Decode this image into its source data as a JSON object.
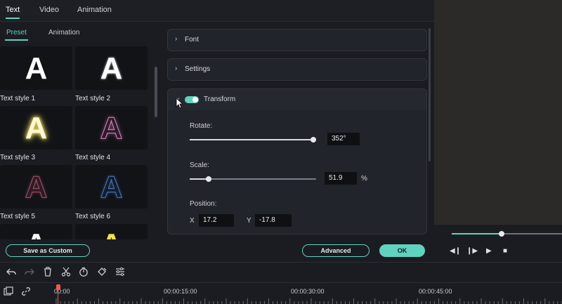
{
  "top_tabs": [
    {
      "label": "Text",
      "active": true
    },
    {
      "label": "Video",
      "active": false
    },
    {
      "label": "Animation",
      "active": false
    }
  ],
  "sub_tabs": [
    {
      "label": "Preset",
      "active": true
    },
    {
      "label": "Animation",
      "active": false
    }
  ],
  "presets": [
    {
      "glyph": "A",
      "label": "Text style 1"
    },
    {
      "glyph": "A",
      "label": "Text style 2"
    },
    {
      "glyph": "A",
      "label": "Text style 3"
    },
    {
      "glyph": "A",
      "label": "Text style 4"
    },
    {
      "glyph": "A",
      "label": "Text style 5"
    },
    {
      "glyph": "A",
      "label": "Text style 6"
    },
    {
      "glyph": "A",
      "label": ""
    },
    {
      "glyph": "A",
      "label": ""
    }
  ],
  "sections": {
    "font": {
      "title": "Font",
      "expanded": false
    },
    "settings": {
      "title": "Settings",
      "expanded": false
    },
    "transform": {
      "title": "Transform",
      "expanded": true,
      "enabled": true,
      "rotate": {
        "label": "Rotate:",
        "value": "352°",
        "fraction": 0.98
      },
      "scale": {
        "label": "Scale:",
        "value": "51.9",
        "unit": "%",
        "fraction": 0.15
      },
      "position": {
        "label": "Position:",
        "x_label": "X",
        "x_value": "17.2",
        "y_label": "Y",
        "y_value": "-17.8"
      }
    }
  },
  "buttons": {
    "save_custom": "Save as Custom",
    "advanced": "Advanced",
    "ok": "OK"
  },
  "player": {
    "progress": 0.45
  },
  "timeline": {
    "timecodes": [
      "00:00",
      "00:00:15:00",
      "00:00:30:00",
      "00:00:45:00"
    ]
  },
  "colors": {
    "accent": "#5fd3bf",
    "playhead": "#f05a4a",
    "background": "#1b1c22"
  },
  "icons": {
    "toolbar": [
      "undo-icon",
      "redo-icon",
      "delete-icon",
      "cut-icon",
      "speed-icon",
      "keyframe-icon",
      "adjust-icon"
    ],
    "timeline": [
      "add-track-icon",
      "link-icon"
    ],
    "player": [
      "prev-frame-icon",
      "next-frame-icon",
      "play-icon",
      "stop-icon"
    ]
  }
}
